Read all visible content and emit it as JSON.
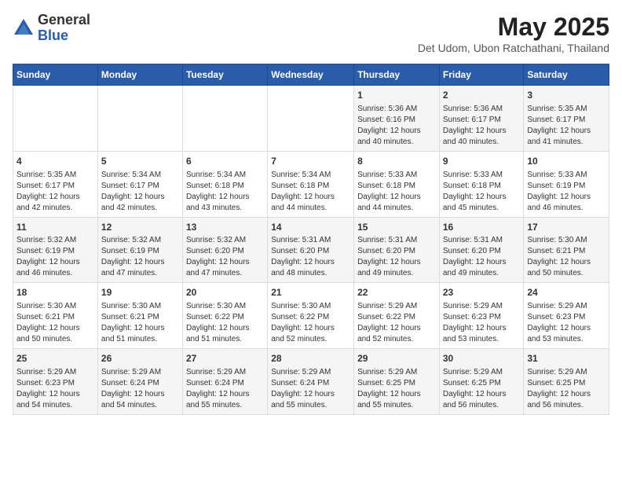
{
  "header": {
    "logo_general": "General",
    "logo_blue": "Blue",
    "month_title": "May 2025",
    "subtitle": "Det Udom, Ubon Ratchathani, Thailand"
  },
  "weekdays": [
    "Sunday",
    "Monday",
    "Tuesday",
    "Wednesday",
    "Thursday",
    "Friday",
    "Saturday"
  ],
  "weeks": [
    [
      {
        "day": "",
        "info": ""
      },
      {
        "day": "",
        "info": ""
      },
      {
        "day": "",
        "info": ""
      },
      {
        "day": "",
        "info": ""
      },
      {
        "day": "1",
        "info": "Sunrise: 5:36 AM\nSunset: 6:16 PM\nDaylight: 12 hours\nand 40 minutes."
      },
      {
        "day": "2",
        "info": "Sunrise: 5:36 AM\nSunset: 6:17 PM\nDaylight: 12 hours\nand 40 minutes."
      },
      {
        "day": "3",
        "info": "Sunrise: 5:35 AM\nSunset: 6:17 PM\nDaylight: 12 hours\nand 41 minutes."
      }
    ],
    [
      {
        "day": "4",
        "info": "Sunrise: 5:35 AM\nSunset: 6:17 PM\nDaylight: 12 hours\nand 42 minutes."
      },
      {
        "day": "5",
        "info": "Sunrise: 5:34 AM\nSunset: 6:17 PM\nDaylight: 12 hours\nand 42 minutes."
      },
      {
        "day": "6",
        "info": "Sunrise: 5:34 AM\nSunset: 6:18 PM\nDaylight: 12 hours\nand 43 minutes."
      },
      {
        "day": "7",
        "info": "Sunrise: 5:34 AM\nSunset: 6:18 PM\nDaylight: 12 hours\nand 44 minutes."
      },
      {
        "day": "8",
        "info": "Sunrise: 5:33 AM\nSunset: 6:18 PM\nDaylight: 12 hours\nand 44 minutes."
      },
      {
        "day": "9",
        "info": "Sunrise: 5:33 AM\nSunset: 6:18 PM\nDaylight: 12 hours\nand 45 minutes."
      },
      {
        "day": "10",
        "info": "Sunrise: 5:33 AM\nSunset: 6:19 PM\nDaylight: 12 hours\nand 46 minutes."
      }
    ],
    [
      {
        "day": "11",
        "info": "Sunrise: 5:32 AM\nSunset: 6:19 PM\nDaylight: 12 hours\nand 46 minutes."
      },
      {
        "day": "12",
        "info": "Sunrise: 5:32 AM\nSunset: 6:19 PM\nDaylight: 12 hours\nand 47 minutes."
      },
      {
        "day": "13",
        "info": "Sunrise: 5:32 AM\nSunset: 6:20 PM\nDaylight: 12 hours\nand 47 minutes."
      },
      {
        "day": "14",
        "info": "Sunrise: 5:31 AM\nSunset: 6:20 PM\nDaylight: 12 hours\nand 48 minutes."
      },
      {
        "day": "15",
        "info": "Sunrise: 5:31 AM\nSunset: 6:20 PM\nDaylight: 12 hours\nand 49 minutes."
      },
      {
        "day": "16",
        "info": "Sunrise: 5:31 AM\nSunset: 6:20 PM\nDaylight: 12 hours\nand 49 minutes."
      },
      {
        "day": "17",
        "info": "Sunrise: 5:30 AM\nSunset: 6:21 PM\nDaylight: 12 hours\nand 50 minutes."
      }
    ],
    [
      {
        "day": "18",
        "info": "Sunrise: 5:30 AM\nSunset: 6:21 PM\nDaylight: 12 hours\nand 50 minutes."
      },
      {
        "day": "19",
        "info": "Sunrise: 5:30 AM\nSunset: 6:21 PM\nDaylight: 12 hours\nand 51 minutes."
      },
      {
        "day": "20",
        "info": "Sunrise: 5:30 AM\nSunset: 6:22 PM\nDaylight: 12 hours\nand 51 minutes."
      },
      {
        "day": "21",
        "info": "Sunrise: 5:30 AM\nSunset: 6:22 PM\nDaylight: 12 hours\nand 52 minutes."
      },
      {
        "day": "22",
        "info": "Sunrise: 5:29 AM\nSunset: 6:22 PM\nDaylight: 12 hours\nand 52 minutes."
      },
      {
        "day": "23",
        "info": "Sunrise: 5:29 AM\nSunset: 6:23 PM\nDaylight: 12 hours\nand 53 minutes."
      },
      {
        "day": "24",
        "info": "Sunrise: 5:29 AM\nSunset: 6:23 PM\nDaylight: 12 hours\nand 53 minutes."
      }
    ],
    [
      {
        "day": "25",
        "info": "Sunrise: 5:29 AM\nSunset: 6:23 PM\nDaylight: 12 hours\nand 54 minutes."
      },
      {
        "day": "26",
        "info": "Sunrise: 5:29 AM\nSunset: 6:24 PM\nDaylight: 12 hours\nand 54 minutes."
      },
      {
        "day": "27",
        "info": "Sunrise: 5:29 AM\nSunset: 6:24 PM\nDaylight: 12 hours\nand 55 minutes."
      },
      {
        "day": "28",
        "info": "Sunrise: 5:29 AM\nSunset: 6:24 PM\nDaylight: 12 hours\nand 55 minutes."
      },
      {
        "day": "29",
        "info": "Sunrise: 5:29 AM\nSunset: 6:25 PM\nDaylight: 12 hours\nand 55 minutes."
      },
      {
        "day": "30",
        "info": "Sunrise: 5:29 AM\nSunset: 6:25 PM\nDaylight: 12 hours\nand 56 minutes."
      },
      {
        "day": "31",
        "info": "Sunrise: 5:29 AM\nSunset: 6:25 PM\nDaylight: 12 hours\nand 56 minutes."
      }
    ]
  ]
}
